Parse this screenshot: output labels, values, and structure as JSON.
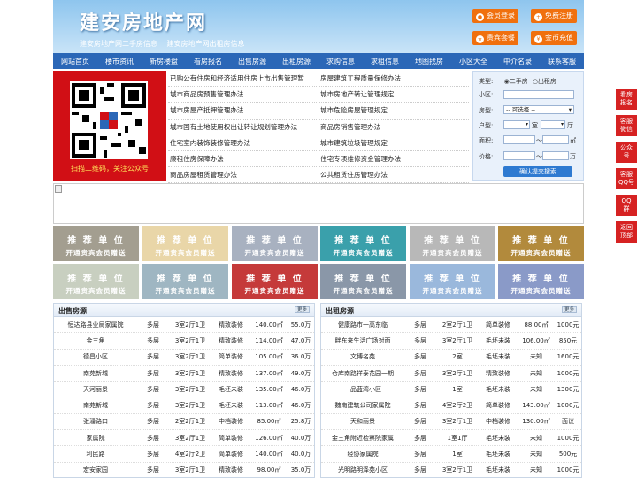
{
  "site": {
    "logo": "建安房地产网",
    "notes": [
      "建安房地产网二手房信息",
      "建安房地产网出租房信息"
    ]
  },
  "header_buttons": [
    {
      "label": "会员登录",
      "icon": "user-icon"
    },
    {
      "label": "免费注册",
      "icon": "user-add-icon"
    },
    {
      "label": "贵宾套餐",
      "icon": "vip-icon"
    },
    {
      "label": "金币充值",
      "icon": "coin-icon"
    }
  ],
  "nav": [
    "网站首页",
    "楼市资讯",
    "新房楼盘",
    "看房报名",
    "出售房源",
    "出租房源",
    "求购信息",
    "求租信息",
    "地图找房",
    "小区大全",
    "中介名录",
    "联系客服"
  ],
  "qr": {
    "caption": "扫描二维码，关注公众号"
  },
  "links": [
    [
      "已购公有住房和经济适用住房上市出售管理暂",
      "房屋建筑工程质量保修办法"
    ],
    [
      "城市商品房预售管理办法",
      "城市房地产转让管理规定"
    ],
    [
      "城市房屋产抵押管理办法",
      "城市危险房屋管理规定"
    ],
    [
      "城市国有土地使用权出让转让规划管理办法",
      "商品房销售管理办法"
    ],
    [
      "住宅室内装饰装修管理办法",
      "城市建筑垃圾管理规定"
    ],
    [
      "廉租住房保障办法",
      "住宅专项维修资金管理办法"
    ],
    [
      "商品房屋租赁管理办法",
      "公共租赁住房管理办法"
    ]
  ],
  "search": {
    "type_label": "类型:",
    "type_options": [
      "二手房",
      "出租房"
    ],
    "community_label": "小区:",
    "housetype_label": "房型:",
    "housetype_select": "-- 可选择 --",
    "layout_label": "户型:",
    "room_unit": "室",
    "hall_unit": "厅",
    "area_label": "面积:",
    "area_sep": "～",
    "area_unit": "㎡",
    "price_label": "价格:",
    "price_sep": "～",
    "price_unit": "万",
    "submit": "确认提交搜索"
  },
  "units": {
    "title": "推 荐 单 位",
    "subtitle": "开通贵宾会员赠送",
    "colors": [
      "#a39e90",
      "#e9d6a8",
      "#a8b1c0",
      "#3aa0ab",
      "#b8b8b8",
      "#b28a3c",
      "#c8cfc0",
      "#9fb6c2",
      "#c53a3a",
      "#8a97a8",
      "#9ab8dc",
      "#8a9ac8"
    ]
  },
  "sale": {
    "title": "出售房源",
    "more": "更多",
    "rows": [
      [
        "恒达路县业局家属院",
        "多层",
        "3室2厅1卫",
        "精致装修",
        "140.00㎡",
        "55.0万"
      ],
      [
        "金三角",
        "多层",
        "3室2厅1卫",
        "精致装修",
        "114.00㎡",
        "47.0万"
      ],
      [
        "德昌小区",
        "多层",
        "3室2厅1卫",
        "简单装修",
        "105.00㎡",
        "36.0万"
      ],
      [
        "南苑新城",
        "多层",
        "3室2厅1卫",
        "精致装修",
        "137.00㎡",
        "49.0万"
      ],
      [
        "天河丽景",
        "多层",
        "3室2厅1卫",
        "毛坯未装",
        "135.00㎡",
        "46.0万"
      ],
      [
        "南苑新城",
        "多层",
        "3室2厅1卫",
        "毛坯未装",
        "113.00㎡",
        "46.0万"
      ],
      [
        "张潘路口",
        "多层",
        "2室2厅1卫",
        "中档装修",
        "85.00㎡",
        "25.8万"
      ],
      [
        "家属院",
        "多层",
        "3室2厅1卫",
        "简单装修",
        "126.00㎡",
        "40.0万"
      ],
      [
        "利民路",
        "多层",
        "4室2厅2卫",
        "简单装修",
        "140.00㎡",
        "40.0万"
      ],
      [
        "宏安家园",
        "多层",
        "3室2厅1卫",
        "精致装修",
        "98.00㎡",
        "35.0万"
      ]
    ]
  },
  "rent": {
    "title": "出租房源",
    "more": "更多",
    "rows": [
      [
        "健康路市一高东临",
        "多层",
        "2室2厅1卫",
        "简单装修",
        "88.00㎡",
        "1000元"
      ],
      [
        "胖东来生活广场对面",
        "多层",
        "3室2厅1卫",
        "毛坯未装",
        "106.00㎡",
        "850元"
      ],
      [
        "文博名苑",
        "多层",
        "2室",
        "毛坯未装",
        "未知",
        "1600元"
      ],
      [
        "仓库南路祥泰花园一期",
        "多层",
        "3室2厅1卫",
        "精致装修",
        "未知",
        "1000元"
      ],
      [
        "一品蓝湾小区",
        "多层",
        "1室",
        "毛坯未装",
        "未知",
        "1300元"
      ],
      [
        "魏南建筑公司家属院",
        "多层",
        "4室2厅2卫",
        "简单装修",
        "143.00㎡",
        "1000元"
      ],
      [
        "天和丽景",
        "多层",
        "3室2厅1卫",
        "中档装修",
        "130.00㎡",
        "面议"
      ],
      [
        "金三角附近检察院家属",
        "多层",
        "1室1厅",
        "毛坯未装",
        "未知",
        "1000元"
      ],
      [
        "经协家属院",
        "多层",
        "1室",
        "毛坯未装",
        "未知",
        "500元"
      ],
      [
        "光明路明泽苑小区",
        "多层",
        "3室2厅1卫",
        "毛坯未装",
        "未知",
        "1000元"
      ]
    ]
  },
  "side": [
    {
      "label": "看房\n报名",
      "color": "#d62222"
    },
    {
      "label": "客服\n微信",
      "color": "#d62222"
    },
    {
      "label": "公众\n号",
      "color": "#d62222"
    },
    {
      "label": "客服\nQQ号",
      "color": "#d62222"
    },
    {
      "label": "QQ\n群",
      "color": "#d62222"
    },
    {
      "label": "返回\n顶部",
      "color": "#d62222"
    }
  ]
}
